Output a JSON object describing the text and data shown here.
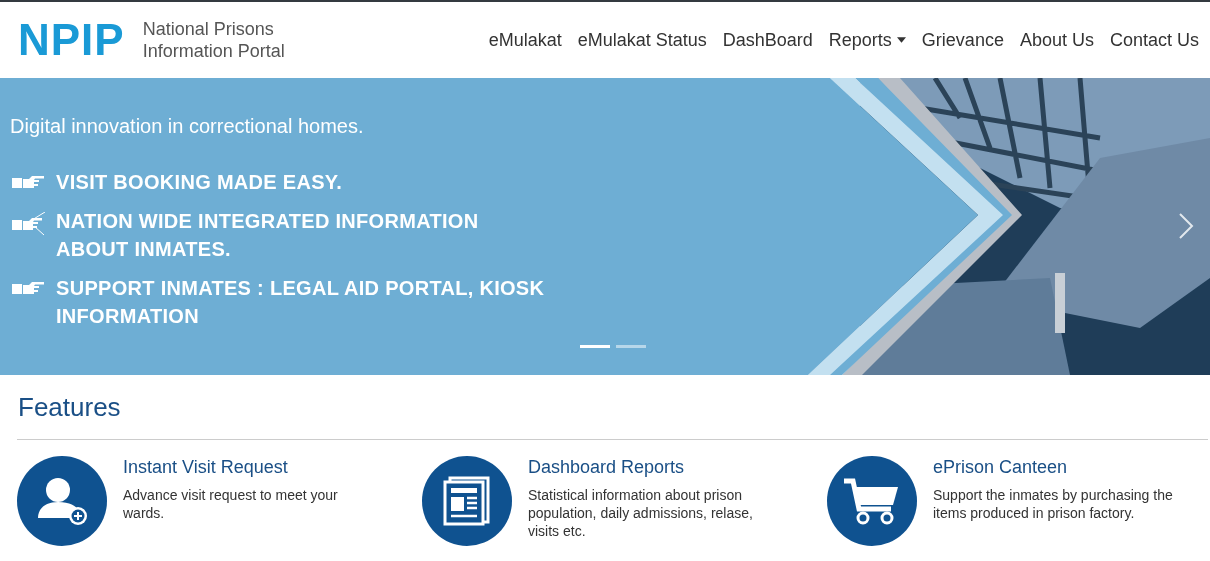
{
  "header": {
    "logo": "NPIP",
    "site_name_lines": [
      "National Prisons",
      "Information Portal"
    ]
  },
  "nav": [
    {
      "label": "eMulakat",
      "kind": "link"
    },
    {
      "label": "eMulakat Status",
      "kind": "link"
    },
    {
      "label": "DashBoard",
      "kind": "link"
    },
    {
      "label": "Reports",
      "kind": "dropdown"
    },
    {
      "label": "Grievance",
      "kind": "link"
    },
    {
      "label": "About Us",
      "kind": "link"
    },
    {
      "label": "Contact Us",
      "kind": "link"
    }
  ],
  "banner": {
    "tagline": "Digital innovation in correctional homes.",
    "points": [
      {
        "text": "VISIT BOOKING MADE EASY.",
        "kind": "pointing"
      },
      {
        "text": "NATION WIDE INTEGRATED INFORMATION ABOUT INMATES.",
        "kind": "strings"
      },
      {
        "text": "SUPPORT INMATES : LEGAL AID PORTAL, KIOSK INFORMATION",
        "kind": "pointing"
      }
    ],
    "slides": [
      {
        "selected": true
      },
      {
        "selected": false
      }
    ]
  },
  "features": {
    "heading": "Features",
    "items": [
      {
        "title": "Instant Visit Request",
        "description": "Advance visit request to meet your wards.",
        "kind": "user-add"
      },
      {
        "title": "Dashboard Reports",
        "description": "Statistical information about prison population, daily admissions, relase, visits etc.",
        "kind": "newspaper"
      },
      {
        "title": "ePrison Canteen",
        "description": "Support the inmates by purchasing the items produced in prison factory.",
        "kind": "cart"
      }
    ]
  }
}
